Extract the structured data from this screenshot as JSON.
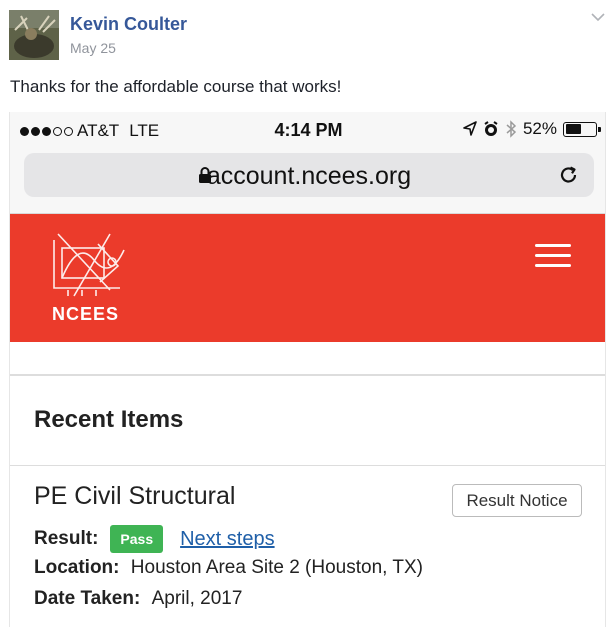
{
  "post": {
    "author": "Kevin Coulter",
    "date": "May 25",
    "text": "Thanks for the affordable course that works!"
  },
  "phone": {
    "status_bar": {
      "carrier": "AT&T",
      "network": "LTE",
      "time": "4:14 PM",
      "battery_percent": "52%",
      "battery_level": 0.52
    },
    "url_bar": {
      "url": "account.ncees.org"
    },
    "header": {
      "logo_text": "NCEES",
      "bg_color": "#eb3b2b"
    },
    "recent_items": {
      "title": "Recent Items",
      "item": {
        "title": "PE Civil Structural",
        "result_notice_label": "Result Notice",
        "result_label": "Result:",
        "result_value": "Pass",
        "next_steps_label": "Next steps",
        "location_label": "Location:",
        "location_value": "Houston Area Site 2 (Houston, TX)",
        "date_label": "Date Taken:",
        "date_value": "April, 2017"
      }
    }
  },
  "colors": {
    "author_link": "#365899",
    "pass_badge": "#3fb454",
    "link": "#1f5fa8"
  }
}
